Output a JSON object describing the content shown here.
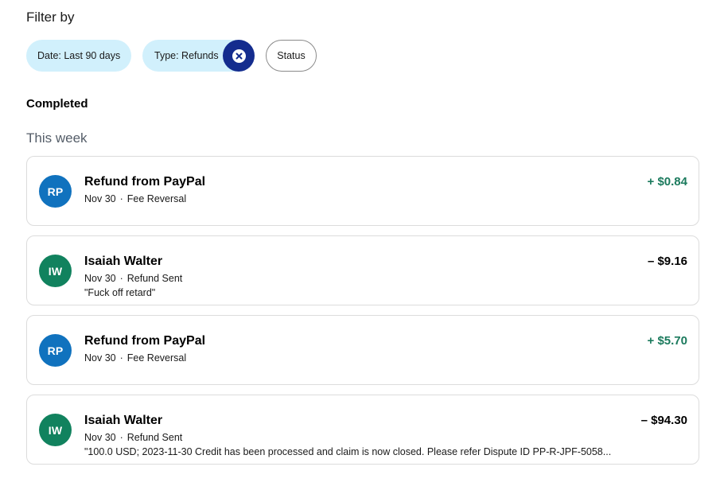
{
  "filter": {
    "title": "Filter by",
    "chips": [
      {
        "label": "Date: Last 90 days"
      },
      {
        "label": "Type: Refunds",
        "clear_icon": "close-circle-icon"
      },
      {
        "label": "Status"
      }
    ]
  },
  "section_title": "Completed",
  "group_title": "This week",
  "colors": {
    "chip_active_bg": "#d1f0fc",
    "clear_button_bg": "#142c8e",
    "positive_amount": "#1b7a5d",
    "negative_amount": "#000000",
    "avatar_blue": "#1072be",
    "avatar_green": "#11825e"
  },
  "transactions": [
    {
      "initials": "RP",
      "avatar_color": "#1072be",
      "name": "Refund from PayPal",
      "date": "Nov 30",
      "dot": "·",
      "type": "Fee Reversal",
      "note": "",
      "amount": "+ $0.84",
      "amount_color": "#1b7a5d"
    },
    {
      "initials": "IW",
      "avatar_color": "#11825e",
      "name": "Isaiah Walter",
      "date": "Nov 30",
      "dot": "·",
      "type": "Refund Sent",
      "note": "\"Fuck off retard\"",
      "amount": "– $9.16",
      "amount_color": "#000000"
    },
    {
      "initials": "RP",
      "avatar_color": "#1072be",
      "name": "Refund from PayPal",
      "date": "Nov 30",
      "dot": "·",
      "type": "Fee Reversal",
      "note": "",
      "amount": "+ $5.70",
      "amount_color": "#1b7a5d"
    },
    {
      "initials": "IW",
      "avatar_color": "#11825e",
      "name": "Isaiah Walter",
      "date": "Nov 30",
      "dot": "·",
      "type": "Refund Sent",
      "note": "\"100.0 USD; 2023-11-30 Credit has been processed and claim is now closed. Please refer Dispute ID PP-R-JPF-5058...",
      "amount": "– $94.30",
      "amount_color": "#000000"
    }
  ]
}
